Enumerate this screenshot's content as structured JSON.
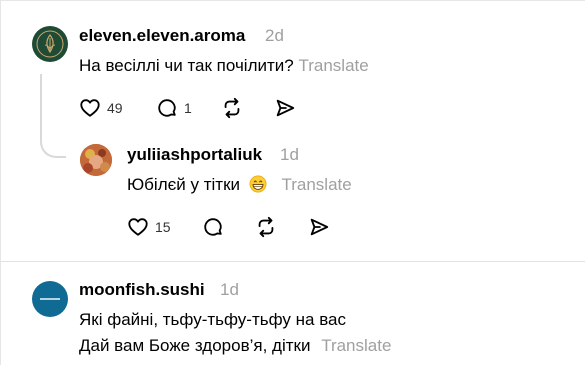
{
  "comments": [
    {
      "username": "eleven.eleven.aroma",
      "time": "2d",
      "text": "На весіллі чи так почілити?",
      "translate": "Translate",
      "likes": "49",
      "replies": "1"
    },
    {
      "username": "yuliiashportaliuk",
      "time": "1d",
      "text": "Юбілєй у тітки",
      "emoji": "grinning-face",
      "translate": "Translate",
      "likes": "15"
    },
    {
      "username": "moonfish.sushi",
      "time": "1d",
      "text_line1": "Які файні, тьфу-тьфу-тьфу на вас",
      "text_line2": "Дай вам Боже здоров’я, дітки",
      "translate": "Translate"
    }
  ],
  "icons": [
    "heart-icon",
    "comment-icon",
    "repost-icon",
    "share-icon"
  ],
  "colors": {
    "muted": "#a0a0a0",
    "avatar_green": "#1e4a36",
    "avatar_blue": "#0f6a94"
  }
}
